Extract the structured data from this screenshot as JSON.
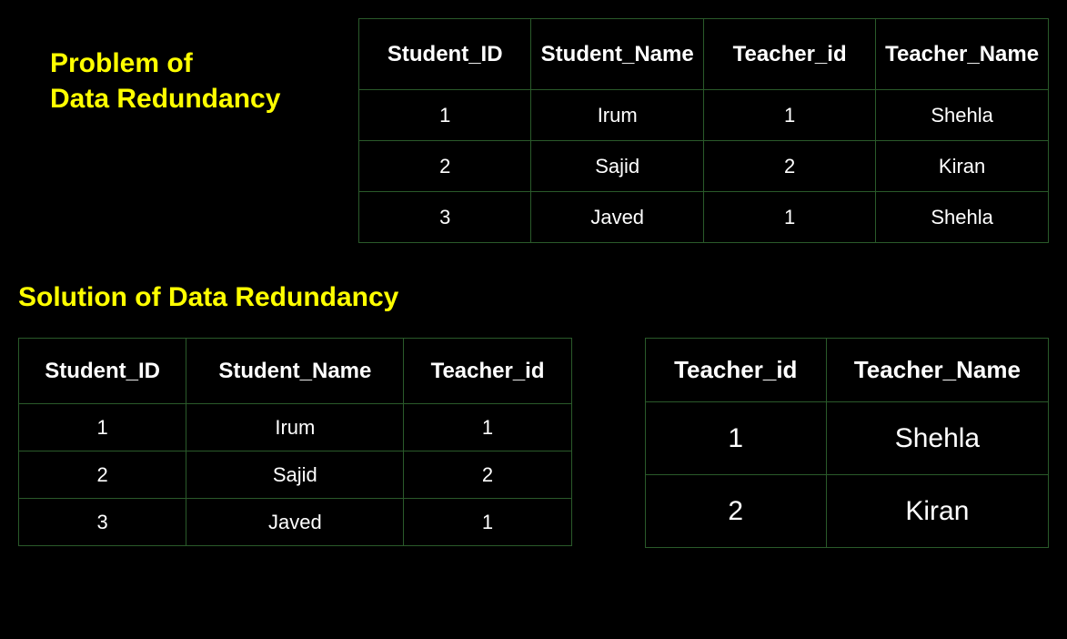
{
  "headings": {
    "problem_line1": "Problem of",
    "problem_line2": "Data Redundancy",
    "solution": "Solution of Data Redundancy"
  },
  "problem_table": {
    "headers": [
      "Student_ID",
      "Student_Name",
      "Teacher_id",
      "Teacher_Name"
    ],
    "rows": [
      [
        "1",
        "Irum",
        "1",
        "Shehla"
      ],
      [
        "2",
        "Sajid",
        "2",
        "Kiran"
      ],
      [
        "3",
        "Javed",
        "1",
        "Shehla"
      ]
    ]
  },
  "students_table": {
    "headers": [
      "Student_ID",
      "Student_Name",
      "Teacher_id"
    ],
    "rows": [
      [
        "1",
        "Irum",
        "1"
      ],
      [
        "2",
        "Sajid",
        "2"
      ],
      [
        "3",
        "Javed",
        "1"
      ]
    ]
  },
  "teachers_table": {
    "headers": [
      "Teacher_id",
      "Teacher_Name"
    ],
    "rows": [
      [
        "1",
        "Shehla"
      ],
      [
        "2",
        "Kiran"
      ]
    ]
  }
}
